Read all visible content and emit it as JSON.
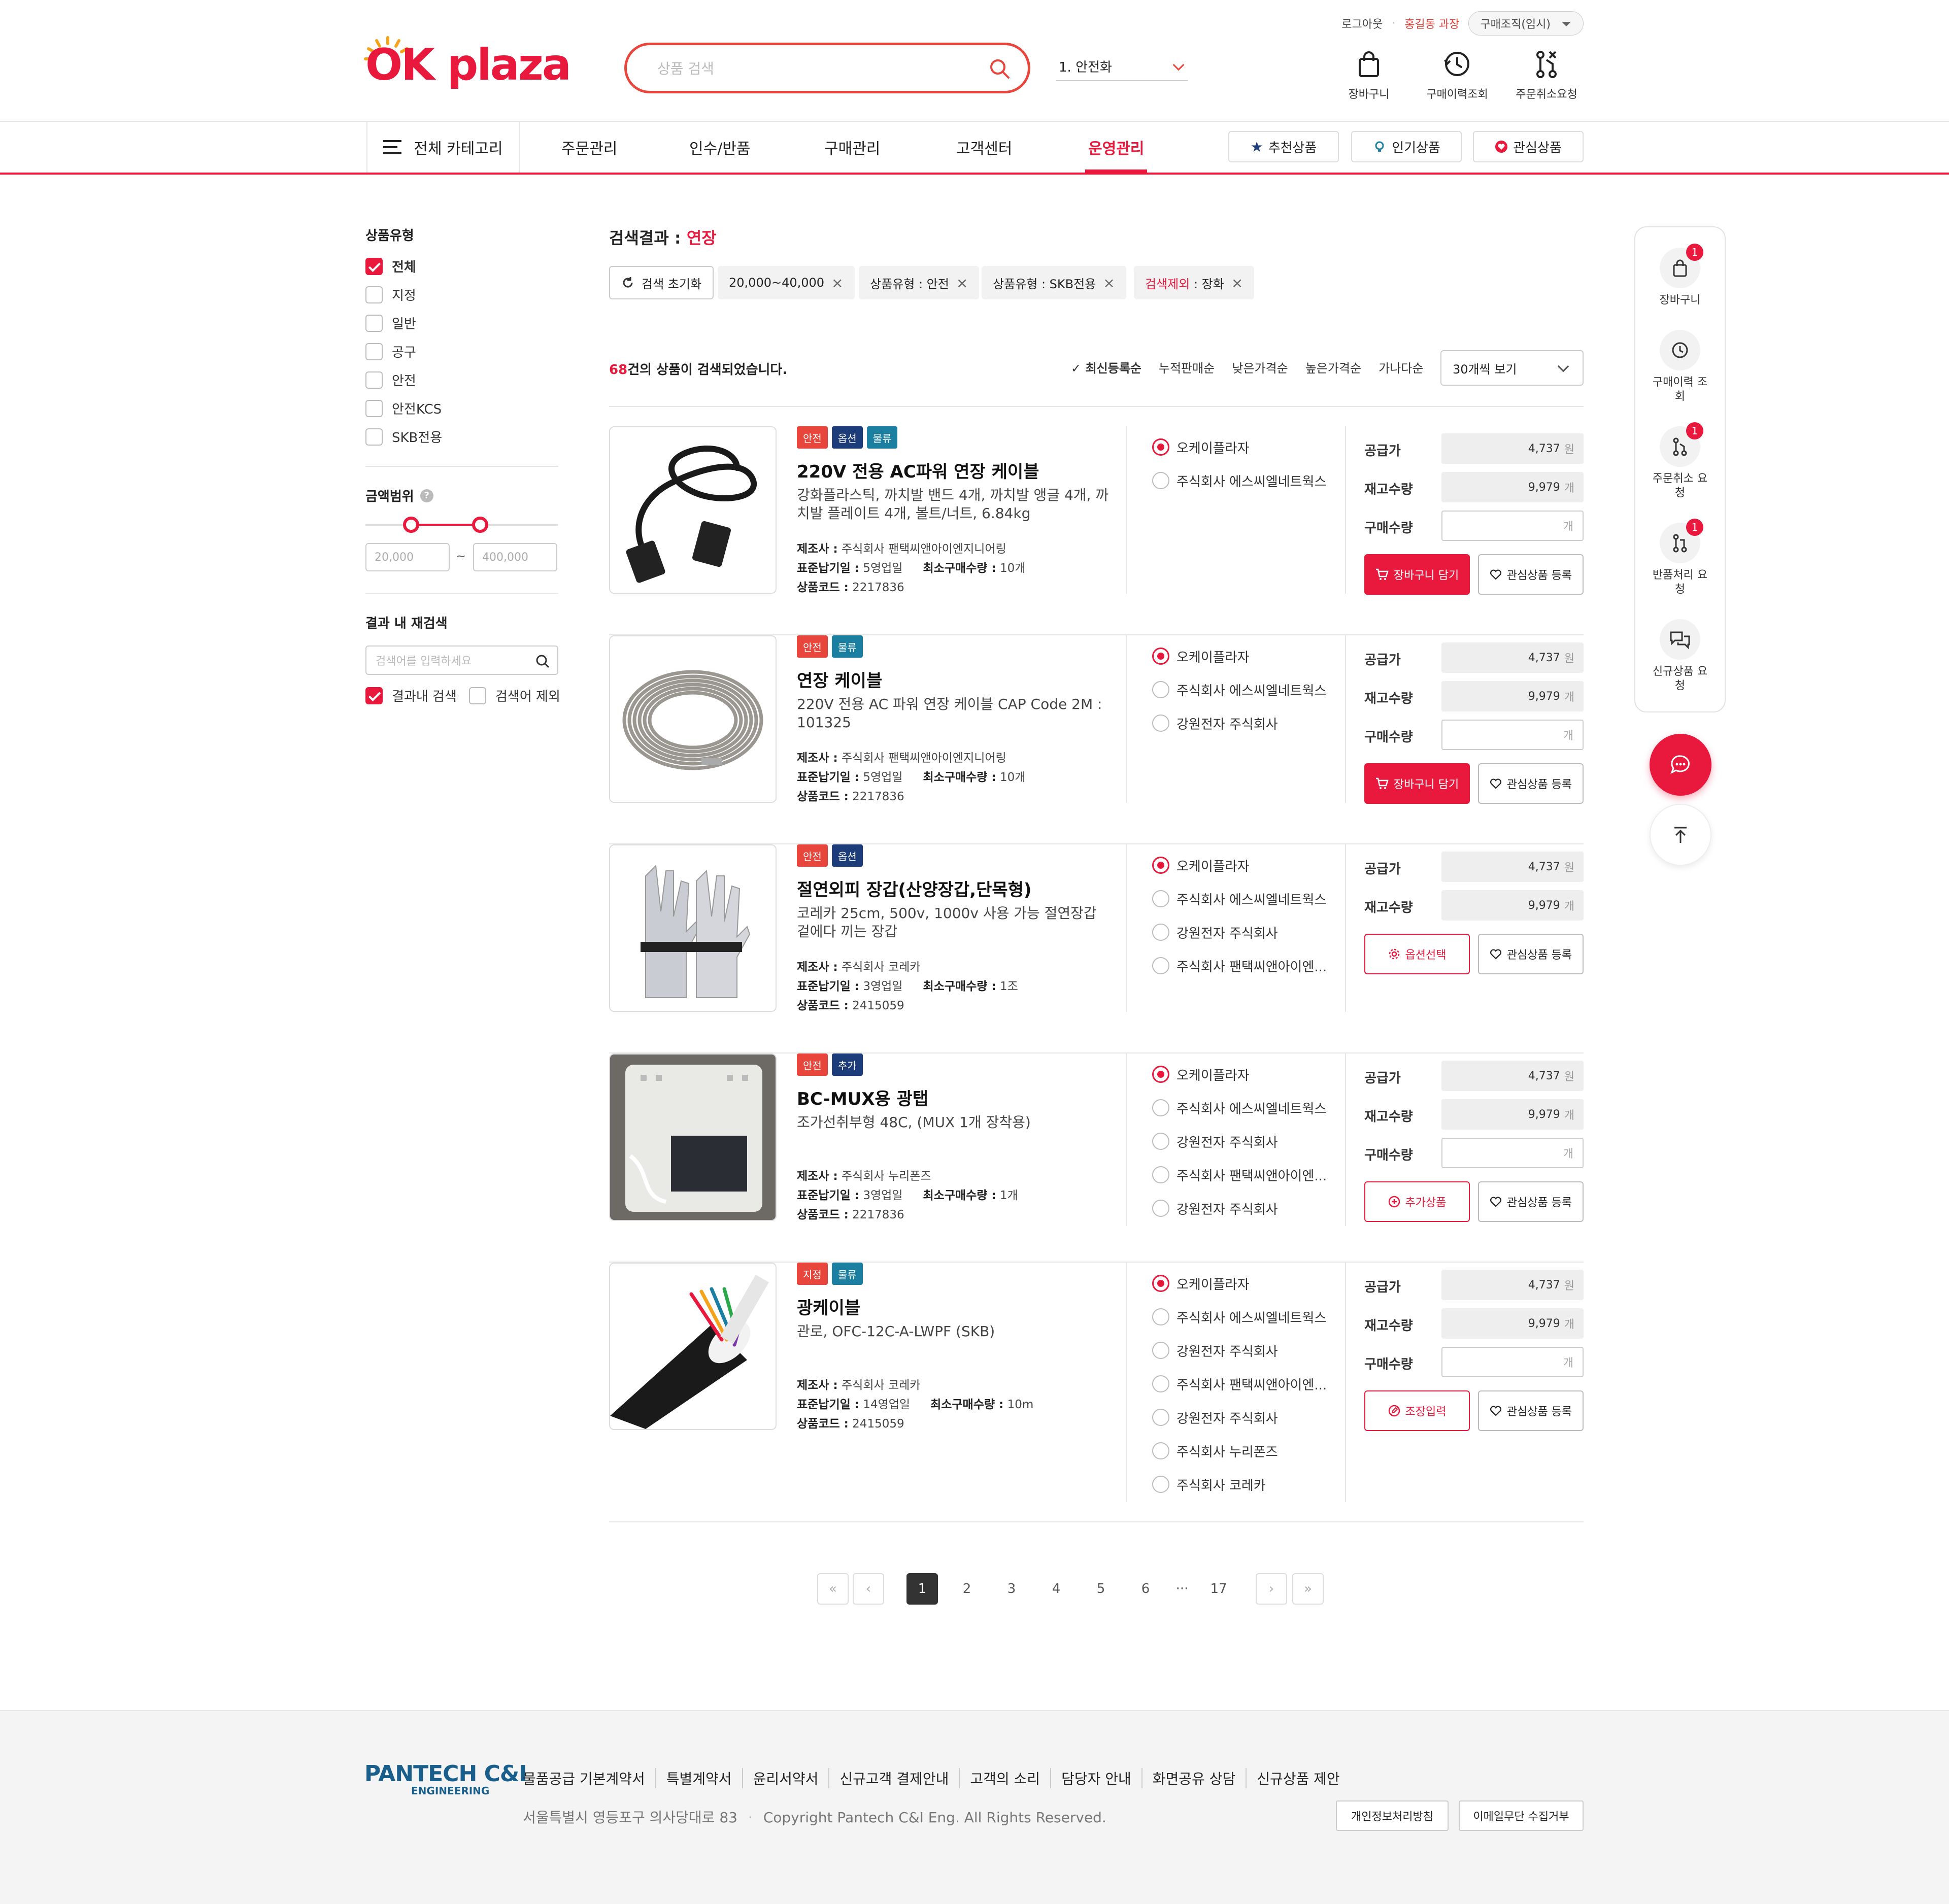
{
  "header": {
    "logout": "로그아웃",
    "user": "홍길동 과장",
    "org": "구매조직(임시)",
    "logo_ok": "OK",
    "logo_plaza": "plaza",
    "search_placeholder": "상품 검색",
    "keyword_select": "1. 안전화",
    "quick": [
      {
        "label": "장바구니",
        "icon": "shopping-bag-icon"
      },
      {
        "label": "구매이력조회",
        "icon": "history-icon"
      },
      {
        "label": "주문취소요청",
        "icon": "order-cancel-icon"
      }
    ]
  },
  "nav": {
    "all_category": "전체 카테고리",
    "items": [
      "주문관리",
      "인수/반품",
      "구매관리",
      "고객센터",
      "운영관리"
    ],
    "active": "운영관리",
    "buttons": [
      "추천상품",
      "인기상품",
      "관심상품"
    ]
  },
  "sidebar": {
    "type_title": "상품유형",
    "types": [
      {
        "label": "전체",
        "checked": true
      },
      {
        "label": "지정",
        "checked": false
      },
      {
        "label": "일반",
        "checked": false
      },
      {
        "label": "공구",
        "checked": false
      },
      {
        "label": "안전",
        "checked": false
      },
      {
        "label": "안전KCS",
        "checked": false
      },
      {
        "label": "SKB전용",
        "checked": false
      }
    ],
    "price_title": "금액범위",
    "price_min": "20,000",
    "range_sep": "~",
    "price_max": "400,000",
    "re_title": "결과 내 재검색",
    "re_placeholder": "검색어를 입력하세요",
    "re_in_result": "결과내 검색",
    "re_exclude": "검색어 제외"
  },
  "results": {
    "title_prefix": "검색결과 :",
    "keyword": "연장",
    "reset": "검색 초기화",
    "chips": [
      {
        "prefix": "",
        "value": "20,000~40,000"
      },
      {
        "prefix": "",
        "value": "상품유형 : 안전"
      },
      {
        "prefix": "",
        "value": "상품유형 : SKB전용"
      },
      {
        "prefix": "검색제외",
        "value": " : 장화"
      }
    ],
    "count": "68",
    "count_suffix": "건의 상품이 검색되었습니다.",
    "sorts": [
      "최신등록순",
      "누적판매순",
      "낮은가격순",
      "높은가격순",
      "가나다순"
    ],
    "per_page": "30개씩 보기"
  },
  "labels": {
    "maker": "제조사 :",
    "lead": "표준납기일 :",
    "minqty": "최소구매수량 :",
    "code": "상품코드 :",
    "price": "공급가",
    "stock": "재고수량",
    "qty": "구매수량",
    "won": "원",
    "ea": "개",
    "wish": "관심상품 등록"
  },
  "products": [
    {
      "tags": [
        {
          "t": "안전",
          "c": "red"
        },
        {
          "t": "옵션",
          "c": "navy"
        },
        {
          "t": "물류",
          "c": "teal"
        }
      ],
      "name": "220V 전용 AC파워 연장 케이블",
      "desc": "강화플라스틱, 까치발 밴드 4개, 까치발 앵글 4개, 까치발 플레이트 4개, 볼트/너트, 6.84kg",
      "maker": "주식회사 팬택씨앤아이엔지니어링",
      "lead": "5영업일",
      "minqty": "10개",
      "code": "2217836",
      "suppliers": [
        "오케이플라자",
        "주식회사 에스씨엘네트웍스"
      ],
      "price": "4,737",
      "stock": "9,979",
      "action": "장바구니 담기",
      "action_type": "cart",
      "qty_field": true,
      "image": "power-cable"
    },
    {
      "tags": [
        {
          "t": "안전",
          "c": "red"
        },
        {
          "t": "물류",
          "c": "teal"
        }
      ],
      "name": "연장 케이블",
      "desc": "220V 전용 AC 파워 연장 케이블 CAP Code 2M : 101325",
      "maker": "주식회사 팬택씨앤아이엔지니어링",
      "lead": "5영업일",
      "minqty": "10개",
      "code": "2217836",
      "suppliers": [
        "오케이플라자",
        "주식회사 에스씨엘네트웍스",
        "강원전자 주식회사"
      ],
      "price": "4,737",
      "stock": "9,979",
      "action": "장바구니 담기",
      "action_type": "cart",
      "qty_field": true,
      "image": "coiled-cable"
    },
    {
      "tags": [
        {
          "t": "안전",
          "c": "red"
        },
        {
          "t": "옵션",
          "c": "navy"
        }
      ],
      "name": "절연외피 장갑(산양장갑,단목형)",
      "desc": "코레카 25cm, 500v, 1000v 사용 가능 절연장갑 겉에다 끼는 장갑",
      "maker": "주식회사 코레카",
      "lead": "3영업일",
      "minqty": "1조",
      "code": "2415059",
      "suppliers": [
        "오케이플라자",
        "주식회사 에스씨엘네트웍스",
        "강원전자 주식회사",
        "주식회사 팬택씨앤아이엔..."
      ],
      "price": "4,737",
      "stock": "9,979",
      "action": "옵션선택",
      "action_type": "option",
      "qty_field": false,
      "image": "gloves"
    },
    {
      "tags": [
        {
          "t": "안전",
          "c": "red"
        },
        {
          "t": "추가",
          "c": "navy"
        }
      ],
      "name": "BC-MUX용 광탭",
      "desc": "조가선취부형 48C, (MUX 1개 장착용)",
      "maker": "주식회사 누리폰즈",
      "lead": "3영업일",
      "minqty": "1개",
      "code": "2217836",
      "suppliers": [
        "오케이플라자",
        "주식회사 에스씨엘네트웍스",
        "강원전자 주식회사",
        "주식회사 팬택씨앤아이엔...",
        "강원전자 주식회사"
      ],
      "price": "4,737",
      "stock": "9,979",
      "action": "추가상품",
      "action_type": "add",
      "qty_field": true,
      "image": "optical-tap"
    },
    {
      "tags": [
        {
          "t": "지정",
          "c": "red"
        },
        {
          "t": "물류",
          "c": "teal"
        }
      ],
      "name": "광케이블",
      "desc": "관로, OFC-12C-A-LWPF (SKB)",
      "maker": "주식회사 코레카",
      "lead": "14영업일",
      "minqty": "10m",
      "code": "2415059",
      "suppliers": [
        "오케이플라자",
        "주식회사 에스씨엘네트웍스",
        "강원전자 주식회사",
        "주식회사 팬택씨앤아이엔...",
        "강원전자 주식회사",
        "주식회사 누리폰즈",
        "주식회사 코레카"
      ],
      "price": "4,737",
      "stock": "9,979",
      "action": "조장입력",
      "action_type": "edit",
      "qty_field": true,
      "image": "fiber-cable"
    }
  ],
  "pagination": {
    "pages": [
      "1",
      "2",
      "3",
      "4",
      "5",
      "6"
    ],
    "ellipsis": "···",
    "last": "17",
    "current": "1"
  },
  "rail": [
    {
      "label": "장바구니",
      "badge": "1",
      "icon": "shopping-bag-icon"
    },
    {
      "label": "구매이력 조회",
      "badge": "",
      "icon": "history-icon"
    },
    {
      "label": "주문취소 요청",
      "badge": "1",
      "icon": "order-cancel-icon"
    },
    {
      "label": "반품처리 요청",
      "badge": "1",
      "icon": "return-icon"
    },
    {
      "label": "신규상품 요청",
      "badge": "",
      "icon": "chat-bubbles-icon"
    }
  ],
  "footer": {
    "logo_top": "PANTECH C&I",
    "logo_bottom": "ENGINEERING",
    "links": [
      "물품공급 기본계약서",
      "특별계약서",
      "윤리서약서",
      "신규고객 결제안내",
      "고객의 소리",
      "담당자 안내",
      "화면공유 상담",
      "신규상품 제안"
    ],
    "address": "서울특별시 영등포구 의사당대로 83",
    "copyright": "Copyright Pantech C&I Eng. All Rights Reserved.",
    "privacy": "개인정보처리방침",
    "email": "이메일무단 수집거부"
  },
  "colors": {
    "brand": "#e8193d",
    "navy": "#1d3c7a",
    "teal": "#1a7fa0"
  }
}
